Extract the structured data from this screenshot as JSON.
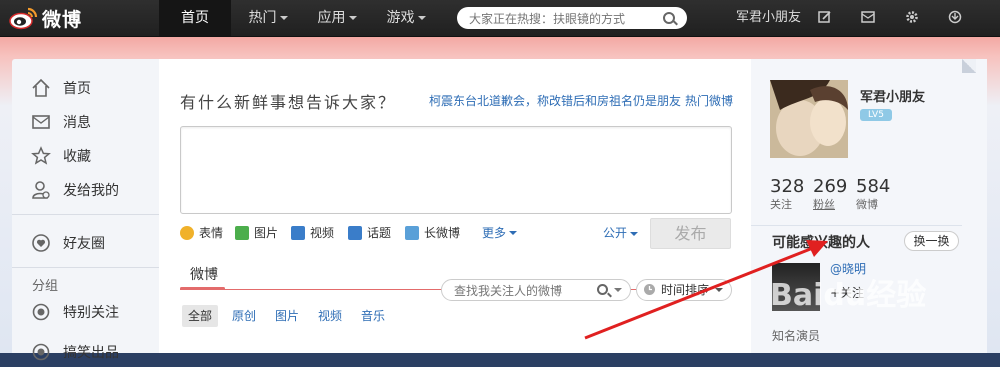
{
  "topbar": {
    "logo_text": "微博",
    "nav": [
      {
        "label": "首页",
        "active": true,
        "caret": false
      },
      {
        "label": "热门",
        "active": false,
        "caret": true
      },
      {
        "label": "应用",
        "active": false,
        "caret": true
      },
      {
        "label": "游戏",
        "active": false,
        "caret": true
      }
    ],
    "search_placeholder": "大家正在热搜：扶眼镜的方式",
    "username": "军君小朋友",
    "icons": [
      "edit-icon",
      "mail-icon",
      "gear-icon",
      "crown-icon"
    ]
  },
  "sidebar": {
    "items": [
      {
        "label": "首页",
        "icon": "home-icon"
      },
      {
        "label": "消息",
        "icon": "mail-icon"
      },
      {
        "label": "收藏",
        "icon": "star-icon"
      },
      {
        "label": "发给我的",
        "icon": "user-at-icon"
      }
    ],
    "friends_circle": {
      "label": "好友圈",
      "icon": "heart-circle-icon"
    },
    "group_label": "分组",
    "special_follow": {
      "label": "特别关注",
      "icon": "target-icon"
    },
    "cut_item": {
      "label": "搞笑出品"
    }
  },
  "publisher": {
    "title": "有什么新鲜事想告诉大家？",
    "hot_topic": "柯震东台北道歉会，称改错后和房祖名仍是朋友",
    "hot_weibo": "热门微博",
    "tools": [
      {
        "label": "表情",
        "icon": "emoji-icon",
        "color": "#f0b12a"
      },
      {
        "label": "图片",
        "icon": "picture-icon",
        "color": "#4cae4c"
      },
      {
        "label": "视频",
        "icon": "video-icon",
        "color": "#3a7dc9"
      },
      {
        "label": "话题",
        "icon": "topic-icon",
        "color": "#3a7dc9"
      },
      {
        "label": "长微博",
        "icon": "long-weibo-icon",
        "color": "#5aa0d8"
      }
    ],
    "more": "更多",
    "visibility": "公开",
    "post_button": "发布"
  },
  "feed": {
    "tab": "微博",
    "search_placeholder": "查找我关注人的微博",
    "sort": "时间排序",
    "filters": [
      "全部",
      "原创",
      "图片",
      "视频",
      "音乐"
    ]
  },
  "profile": {
    "name": "军君小朋友",
    "level": "LV5",
    "stats": [
      {
        "num": "328",
        "label": "关注"
      },
      {
        "num": "269",
        "label": "粉丝"
      },
      {
        "num": "584",
        "label": "微博"
      }
    ]
  },
  "recommend": {
    "title": "可能感兴趣的人",
    "swap": "换一换",
    "person_name": "@晓明",
    "follow_label": "+关注",
    "description": "知名演员"
  },
  "colors": {
    "accent": "#2e6db5",
    "annotation": "#e02020"
  },
  "watermark": "Baidu经验"
}
